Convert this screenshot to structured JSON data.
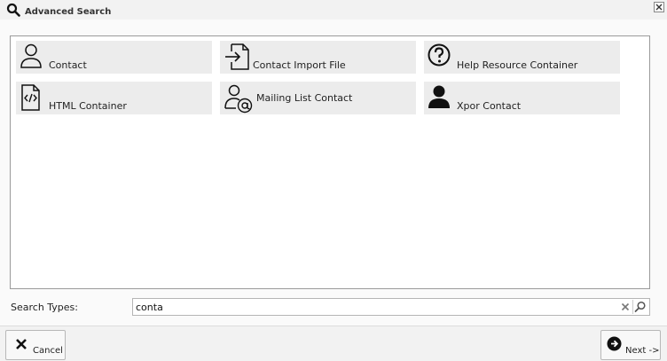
{
  "dialog": {
    "title": "Advanced Search",
    "icons": {
      "title": "magnifier-icon",
      "close": "close-icon"
    }
  },
  "results": [
    {
      "label": "Contact",
      "icon": "person-outline-icon"
    },
    {
      "label": "Contact Import File",
      "icon": "file-import-icon"
    },
    {
      "label": "Help Resource Container",
      "icon": "question-circle-icon"
    },
    {
      "label": "HTML Container",
      "icon": "code-file-icon"
    },
    {
      "label": "Mailing List Contact",
      "icon": "person-at-icon"
    },
    {
      "label": "Xpor Contact",
      "icon": "person-solid-icon"
    }
  ],
  "search": {
    "label": "Search Types:",
    "value": "conta",
    "clear_icon": "clear-icon",
    "go_icon": "search-icon"
  },
  "footer": {
    "cancel_label": "Cancel",
    "next_label": "Next ->",
    "cancel_icon": "x-icon",
    "next_icon": "arrow-right-circle-icon"
  }
}
